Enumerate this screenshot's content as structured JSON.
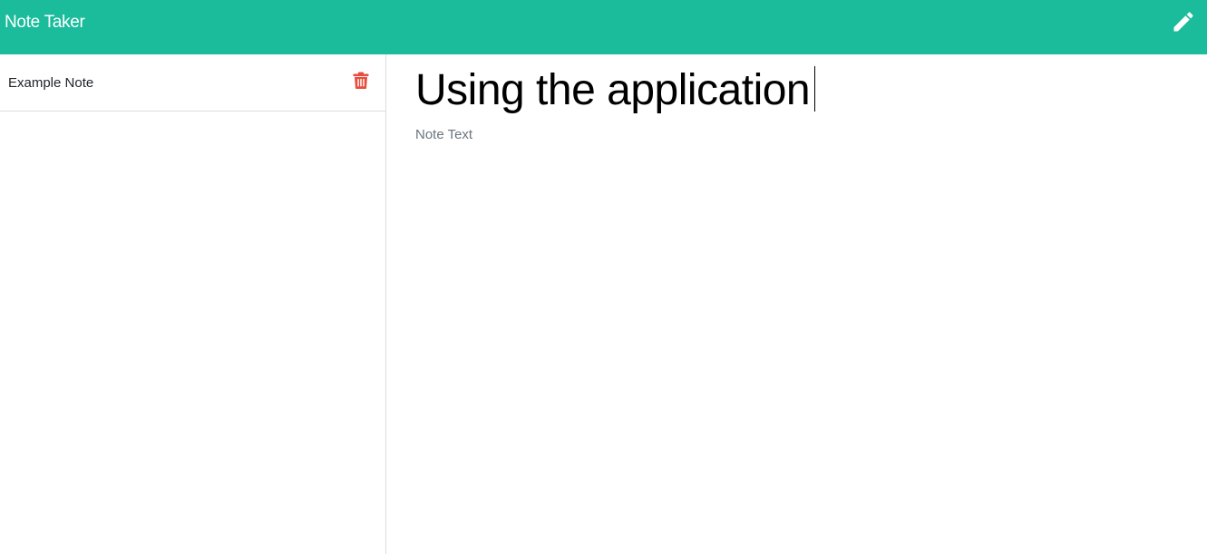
{
  "app": {
    "title": "Note Taker",
    "accent_color": "#1abc9c",
    "edit_icon": "pencil-icon"
  },
  "sidebar": {
    "notes": [
      {
        "title": "Example Note",
        "delete_icon": "trash-icon",
        "delete_color": "#e74c3c"
      }
    ]
  },
  "editor": {
    "title_value": "Using the application",
    "text_placeholder": "Note Text",
    "text_value": ""
  }
}
